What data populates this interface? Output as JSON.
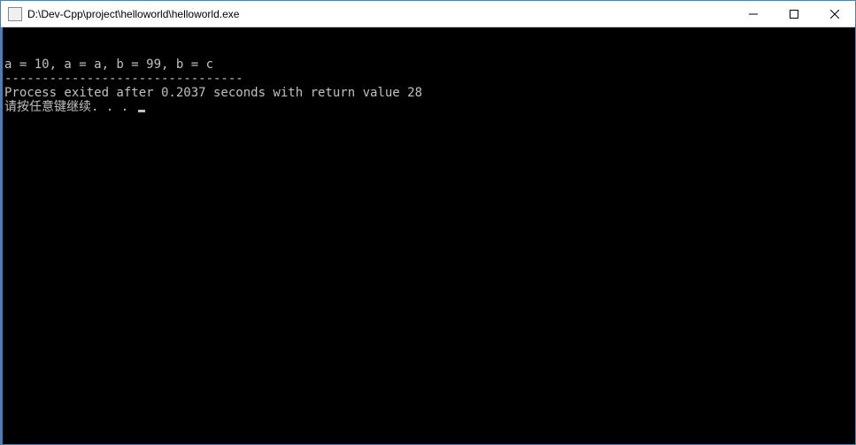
{
  "titlebar": {
    "title": "D:\\Dev-Cpp\\project\\helloworld\\helloworld.exe"
  },
  "console": {
    "line1": "a = 10, a = a, b = 99, b = c",
    "separator": "--------------------------------",
    "line2": "Process exited after 0.2037 seconds with return value 28",
    "line3": "请按任意键继续. . . "
  }
}
